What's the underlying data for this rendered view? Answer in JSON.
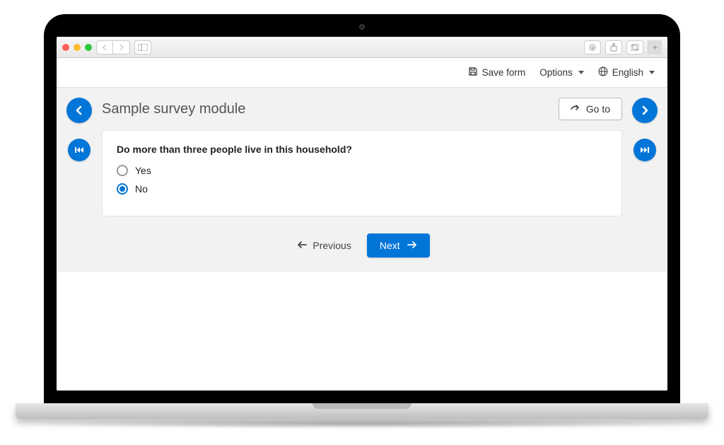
{
  "toolbar": {
    "save_label": "Save form",
    "options_label": "Options",
    "language_label": "English"
  },
  "survey": {
    "title": "Sample survey module",
    "goto_label": "Go to",
    "question": "Do more than three people live in this household?",
    "options": [
      {
        "label": "Yes",
        "selected": false
      },
      {
        "label": "No",
        "selected": true
      }
    ],
    "prev_label": "Previous",
    "next_label": "Next"
  }
}
